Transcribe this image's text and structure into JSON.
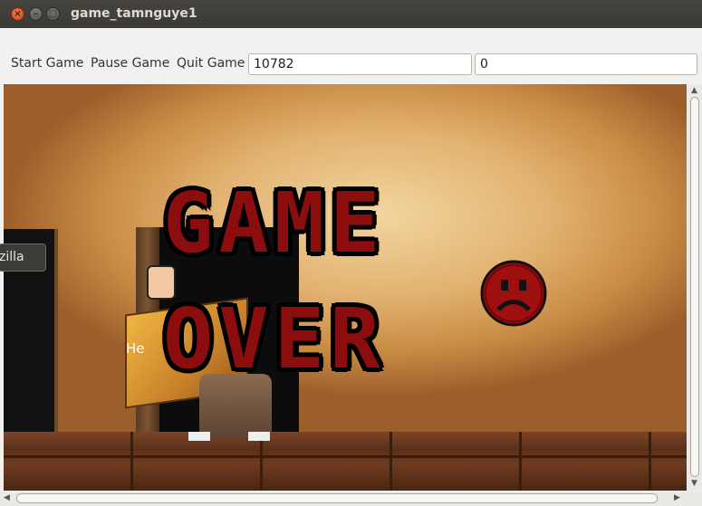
{
  "window": {
    "title": "game_tamnguye1",
    "close_glyph": "×",
    "minimize_glyph": "–",
    "maximize_glyph": "□"
  },
  "toolbar": {
    "start_label": "Start Game",
    "pause_label": "Pause Game",
    "quit_label": "Quit Game",
    "score_value": "10782",
    "second_value": "0"
  },
  "scene": {
    "game_over_line1": "GAME",
    "game_over_line2": "OVER",
    "hello_text": "He",
    "popup_text": "zilla"
  },
  "colors": {
    "accent_red": "#8b0d0d",
    "titlebar": "#3c3b37"
  },
  "icons": {
    "sad_face": "sad-face-icon",
    "close": "close-icon",
    "minimize": "minimize-icon",
    "maximize": "maximize-icon"
  }
}
